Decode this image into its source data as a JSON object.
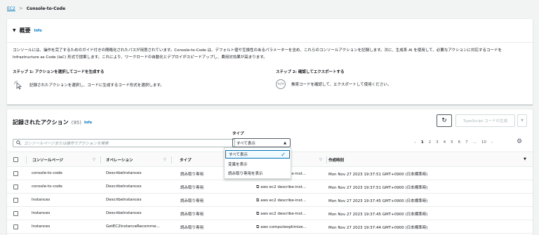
{
  "breadcrumb": {
    "root": "EC2",
    "separator": ">",
    "current": "Console-to-Code"
  },
  "overview": {
    "title": "概要",
    "info": "Info",
    "description": "コンソールには、操作を完了するためのガイド付きの簡略化されたパスが用意されています。Console-to-Code は、デフォルト値や互換性のあるパラメーターを含め、これらのコンソールアクションを記録します。次に、生成系 AI を使用して、必要なアクションに対応するコードを Infrastructure as Code (IaC) 形式で提案します。これにより、ワークロードの自動化とデプロイがスピードアップし、費用対効果が高まります。",
    "step1_title": "ステップ 1: アクションを選択してコードを生成する",
    "step1_text": "記録されたアクションを選択し、コードに生成するコード形式を選択します。",
    "step2_title": "ステップ 2: 確認してエクスポートする",
    "step2_text": "推奨コードを確認して、エクスポートして使用ください。"
  },
  "actions": {
    "title": "記録されたアクション",
    "count": "(95)",
    "info": "Info",
    "generate_label": "TypeScript コードの生成",
    "search_placeholder": "コンソールページまたは操作でアクションを検索",
    "type_label": "タイプ",
    "type_selected": "すべて表示",
    "type_options": [
      "すべて表示",
      "変異を表示",
      "読み取り専用を表示"
    ],
    "pager": {
      "pages": [
        "1",
        "2",
        "3",
        "4",
        "5",
        "6",
        "7",
        "...",
        "10"
      ],
      "current": "1"
    },
    "columns": {
      "page": "コンソールページ",
      "operation": "オペレーション",
      "type": "タイプ",
      "time": "作成時刻"
    },
    "rows": [
      {
        "page": "console-to-code",
        "operation": "DescribeInstances",
        "type": "読み取り専用",
        "cli": "aws ec2 describe-inst...",
        "time": "Mon Nov 27 2023 19:37:51 GMT+0900 (日本標準時)"
      },
      {
        "page": "console-to-code",
        "operation": "DescribeInstances",
        "type": "読み取り専用",
        "cli": "aws ec2 describe-inst...",
        "time": "Mon Nov 27 2023 19:37:51 GMT+0900 (日本標準時)"
      },
      {
        "page": "Instances",
        "operation": "DescribeInstances",
        "type": "読み取り専用",
        "cli": "aws ec2 describe-inst...",
        "time": "Mon Nov 27 2023 19:37:45 GMT+0900 (日本標準時)"
      },
      {
        "page": "Instances",
        "operation": "DescribeInstances",
        "type": "読み取り専用",
        "cli": "aws ec2 describe-inst...",
        "time": "Mon Nov 27 2023 19:37:45 GMT+0900 (日本標準時)"
      },
      {
        "page": "Instances",
        "operation": "GetEC2InstanceRecomme...",
        "type": "読み取り専用",
        "cli": "aws computeoptimize...",
        "time": "Mon Nov 27 2023 19:37:44 GMT+0900 (日本標準時)"
      }
    ]
  }
}
